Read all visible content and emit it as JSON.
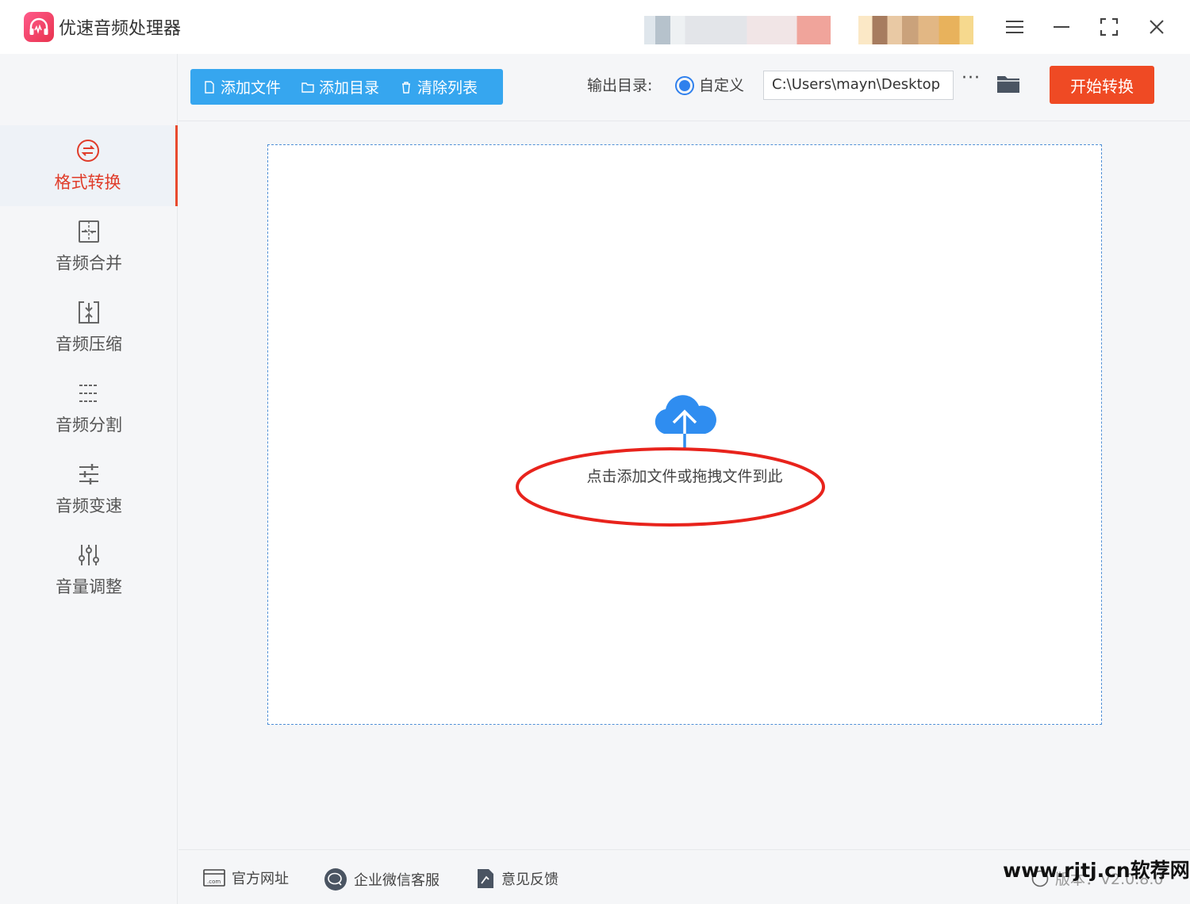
{
  "app": {
    "title": "优速音频处理器"
  },
  "window": {
    "menu_icon": "menu-icon",
    "min_icon": "minimize-icon",
    "max_icon": "maximize-icon",
    "close_icon": "close-icon"
  },
  "sidebar": {
    "items": [
      {
        "label": "格式转换",
        "icon": "format-convert-icon",
        "active": true
      },
      {
        "label": "音频合并",
        "icon": "merge-icon"
      },
      {
        "label": "音频压缩",
        "icon": "compress-icon"
      },
      {
        "label": "音频分割",
        "icon": "split-icon"
      },
      {
        "label": "音频变速",
        "icon": "speed-icon"
      },
      {
        "label": "音量调整",
        "icon": "volume-icon"
      }
    ]
  },
  "toolbar": {
    "add_file": "添加文件",
    "add_dir": "添加目录",
    "clear_list": "清除列表",
    "output_label": "输出目录:",
    "custom_label": "自定义",
    "output_path": "C:\\Users\\mayn\\Desktop",
    "more": "···",
    "start": "开始转换"
  },
  "dropzone": {
    "hint": "点击添加文件或拖拽文件到此"
  },
  "footer": {
    "website": "官方网址",
    "wechat": "企业微信客服",
    "feedback": "意见反馈",
    "version": "版本：V2.0.8.0"
  },
  "watermark": "www.rjtj.cn软荐网",
  "colors": {
    "accent_blue": "#36a6ef",
    "start_red": "#ef4a24",
    "active_red": "#e03c2a",
    "annotation_red": "#e8231c"
  }
}
